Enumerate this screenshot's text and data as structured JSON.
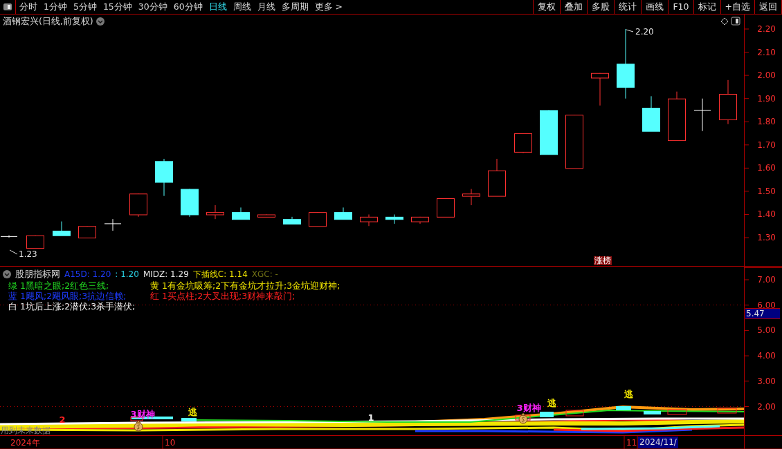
{
  "toolbar": {
    "periods": [
      {
        "label": "分时",
        "selected": false
      },
      {
        "label": "1分钟",
        "selected": false
      },
      {
        "label": "5分钟",
        "selected": false
      },
      {
        "label": "15分钟",
        "selected": false
      },
      {
        "label": "30分钟",
        "selected": false
      },
      {
        "label": "60分钟",
        "selected": false
      },
      {
        "label": "日线",
        "selected": true
      },
      {
        "label": "周线",
        "selected": false
      },
      {
        "label": "月线",
        "selected": false
      },
      {
        "label": "多周期",
        "selected": false
      },
      {
        "label": "更多 >",
        "selected": false
      }
    ],
    "actions": [
      "复权",
      "叠加",
      "多股",
      "统计",
      "画线",
      "F10",
      "标记",
      "+自选",
      "返回"
    ]
  },
  "price_chart": {
    "title": "酒钢宏兴(日线,前复权)",
    "axis_labels": [
      "2.20",
      "2.10",
      "2.00",
      "1.90",
      "1.80",
      "1.70",
      "1.60",
      "1.50",
      "1.40",
      "1.30"
    ],
    "high_label": "2.20",
    "low_label": "1.23",
    "tag": "涨榜"
  },
  "indicator": {
    "title": "股朋指标网",
    "values": [
      {
        "text": "A15D: 1.20",
        "color": "#1e3cff"
      },
      {
        "text": ": 1.20",
        "color": "#2ad4e8"
      },
      {
        "text": "MIDZ: 1.29",
        "color": "#e8e8e8"
      },
      {
        "text": "下插线C: 1.14",
        "color": "#f2e600"
      },
      {
        "text": "XGC: -",
        "color": "#6e6e14"
      }
    ],
    "legend": [
      {
        "text": "绿 1黑暗之眼;2红色三线;",
        "color": "#22dd22"
      },
      {
        "text": "黄 1有金坑吸筹;2下有金坑才拉升;3金坑迎财神;",
        "color": "#f2e600"
      },
      {
        "text": "蓝 1飓风;2飓风眼;3抗边信赖;",
        "color": "#1e3cff"
      },
      {
        "text": "红 1买点柱;2大叉出现;3财神来敲门;",
        "color": "#ff2020"
      },
      {
        "text": "白 1坑后上涨;2潜伏;3杀手潜伏;",
        "color": "#f0f0f0"
      }
    ],
    "axis_labels": [
      "7.00",
      "6.00",
      "5.00",
      "4.00",
      "3.00",
      "2.00"
    ],
    "current_value": "5.47",
    "markers": [
      {
        "text": "2",
        "color": "#ff2020"
      },
      {
        "text": "3财神",
        "color": "#ff22ff"
      },
      {
        "text": "逃",
        "color": "#f2e600"
      },
      {
        "text": "1",
        "color": "#f0f0f0"
      },
      {
        "text": "3财神",
        "color": "#ff22ff"
      },
      {
        "text": "逃",
        "color": "#f2e600"
      },
      {
        "text": "逃",
        "color": "#f2e600"
      }
    ],
    "warning": "用到未来数据"
  },
  "date_axis": [
    "2024年",
    "10",
    "11",
    "2024/11/"
  ]
}
